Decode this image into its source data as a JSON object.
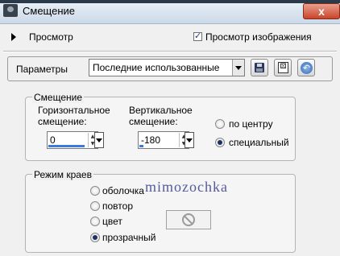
{
  "window": {
    "title": "Смещение",
    "close_label": "x"
  },
  "preview": {
    "label": "Просмотр",
    "checkbox_label": "Просмотр изображения",
    "checkbox_checked": true
  },
  "params": {
    "label": "Параметры",
    "selected": "Последние использованные"
  },
  "offset": {
    "title": "Смещение",
    "horizontal": {
      "label_line1": "Горизонтальное",
      "label_line2": "смещение:",
      "value": "0",
      "level": 0.9
    },
    "vertical": {
      "label_line1": "Вертикальное",
      "label_line2": "смещение:",
      "value": "-180",
      "level": 0.1
    },
    "options": [
      {
        "label": "по центру",
        "selected": false
      },
      {
        "label": "специальный",
        "selected": true
      }
    ]
  },
  "edge": {
    "title": "Режим краев",
    "options": [
      {
        "label": "оболочка",
        "selected": false
      },
      {
        "label": "повтор",
        "selected": false
      },
      {
        "label": "цвет",
        "selected": false
      },
      {
        "label": "прозрачный",
        "selected": true
      }
    ]
  },
  "watermark": "mimozochka",
  "icons": {
    "save": "save-icon",
    "randomize": "dice-icon",
    "reset": "reset-icon",
    "color_none": "no-color-icon"
  }
}
